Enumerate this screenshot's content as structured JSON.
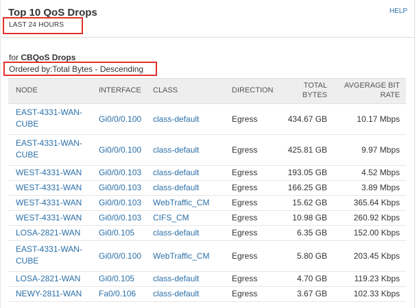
{
  "header": {
    "title": "Top 10 QoS Drops",
    "help_label": "HELP",
    "period": "LAST 24 HOURS"
  },
  "subtitle": {
    "for_prefix": "for",
    "for_value": "CBQoS Drops",
    "ordered_by": "Ordered by:Total Bytes - Descending"
  },
  "table": {
    "columns": {
      "node": "NODE",
      "interface": "INTERFACE",
      "class": "CLASS",
      "direction": "DIRECTION",
      "total_bytes_1": "TOTAL",
      "total_bytes_2": "BYTES",
      "rate_1": "AVGERAGE BIT",
      "rate_2": "RATE"
    },
    "rows": [
      {
        "node": "EAST-4331-WAN-CUBE",
        "interface": "Gi0/0/0.100",
        "class": "class-default",
        "direction": "Egress",
        "total_bytes": "434.67 GB",
        "rate": "10.17 Mbps"
      },
      {
        "node": "EAST-4331-WAN-CUBE",
        "interface": "Gi0/0/0.100",
        "class": "class-default",
        "direction": "Egress",
        "total_bytes": "425.81 GB",
        "rate": "9.97 Mbps"
      },
      {
        "node": "WEST-4331-WAN",
        "interface": "Gi0/0/0.103",
        "class": "class-default",
        "direction": "Egress",
        "total_bytes": "193.05 GB",
        "rate": "4.52 Mbps"
      },
      {
        "node": "WEST-4331-WAN",
        "interface": "Gi0/0/0.103",
        "class": "class-default",
        "direction": "Egress",
        "total_bytes": "166.25 GB",
        "rate": "3.89 Mbps"
      },
      {
        "node": "WEST-4331-WAN",
        "interface": "Gi0/0/0.103",
        "class": "WebTraffic_CM",
        "direction": "Egress",
        "total_bytes": "15.62 GB",
        "rate": "365.64 Kbps"
      },
      {
        "node": "WEST-4331-WAN",
        "interface": "Gi0/0/0.103",
        "class": "CIFS_CM",
        "direction": "Egress",
        "total_bytes": "10.98 GB",
        "rate": "260.92 Kbps"
      },
      {
        "node": "LOSA-2821-WAN",
        "interface": "Gi0/0.105",
        "class": "class-default",
        "direction": "Egress",
        "total_bytes": "6.35 GB",
        "rate": "152.00 Kbps"
      },
      {
        "node": "EAST-4331-WAN-CUBE",
        "interface": "Gi0/0/0.100",
        "class": "WebTraffic_CM",
        "direction": "Egress",
        "total_bytes": "5.80 GB",
        "rate": "203.45 Kbps"
      },
      {
        "node": "LOSA-2821-WAN",
        "interface": "Gi0/0.105",
        "class": "class-default",
        "direction": "Egress",
        "total_bytes": "4.70 GB",
        "rate": "119.23 Kbps"
      },
      {
        "node": "NEWY-2811-WAN",
        "interface": "Fa0/0.106",
        "class": "class-default",
        "direction": "Egress",
        "total_bytes": "3.67 GB",
        "rate": "102.33 Kbps"
      }
    ]
  },
  "colors": {
    "link": "#2a6fa8",
    "highlight": "#e0312b",
    "header_bg": "#eeeeee"
  }
}
